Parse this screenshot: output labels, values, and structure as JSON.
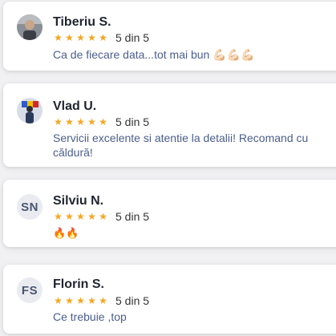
{
  "colors": {
    "star": "#f5a623",
    "review_text": "#4b5e8c",
    "initials_bg": "#e9ebf0",
    "initials_text": "#4a5572"
  },
  "star_icon": "★",
  "reviews": [
    {
      "name": "Tiberiu S.",
      "avatar": "photo",
      "rating": 5,
      "rating_text": "5 din 5",
      "text": "Ca de fiecare data...tot mai bun 💪🏻💪🏻💪🏻"
    },
    {
      "name": "Vlad U.",
      "avatar": "photo",
      "rating": 5,
      "rating_text": "5 din 5",
      "text": "Servicii excelente si atentie la detalii! Recomand cu căldură!"
    },
    {
      "name": "Silviu N.",
      "avatar": "SN",
      "rating": 5,
      "rating_text": "5 din 5",
      "text": "🔥🔥"
    },
    {
      "name": "Florin S.",
      "avatar": "FS",
      "rating": 5,
      "rating_text": "5 din 5",
      "text": "Ce trebuie ,top"
    }
  ]
}
